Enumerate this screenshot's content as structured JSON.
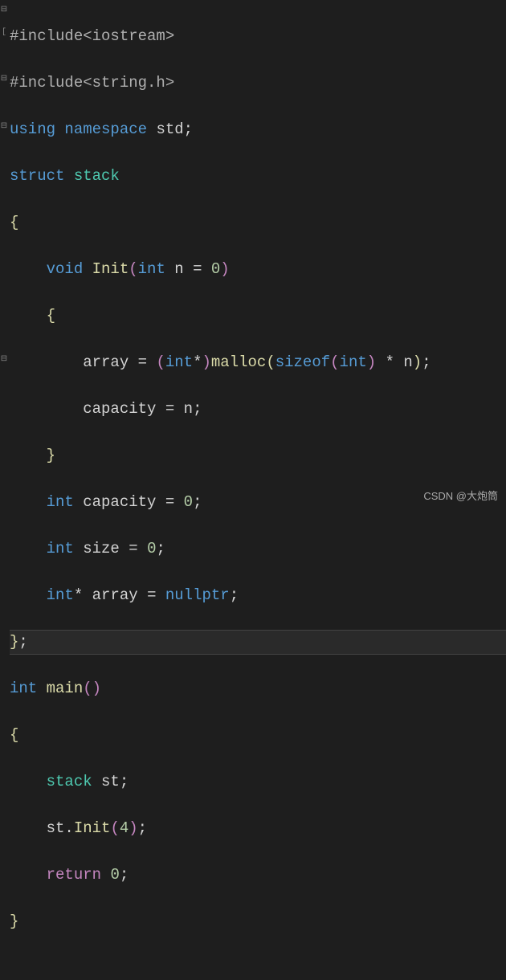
{
  "gutter": {
    "fold1": "⊟",
    "fold2": "[",
    "fold3": "⊟",
    "fold4": "⊟",
    "fold5": "⊟"
  },
  "code": {
    "l1": {
      "s1": "#include",
      "s2": "<iostream>"
    },
    "l2": {
      "s1": "#include",
      "s2": "<string.h>"
    },
    "l3": {
      "s1": "using",
      "s2": " ",
      "s3": "namespace",
      "s4": " std",
      "s5": ";"
    },
    "l4": {
      "s1": "struct",
      "s2": " ",
      "s3": "stack"
    },
    "l5": {
      "s1": "{"
    },
    "l6": {
      "s1": "    ",
      "s2": "void",
      "s3": " ",
      "s4": "Init",
      "s5": "(",
      "s6": "int",
      "s7": " n ",
      "s8": "=",
      "s9": " ",
      "s10": "0",
      "s11": ")"
    },
    "l7": {
      "s1": "    ",
      "s2": "{"
    },
    "l8": {
      "s1": "        array ",
      "s2": "=",
      "s3": " ",
      "s4": "(",
      "s5": "int",
      "s6": "*",
      "s7": ")",
      "s8": "malloc",
      "s9": "(",
      "s10": "sizeof",
      "s11": "(",
      "s12": "int",
      "s13": ")",
      "s14": " ",
      "s15": "*",
      "s16": " n",
      "s17": ")",
      "s18": ";"
    },
    "l9": {
      "s1": "        capacity ",
      "s2": "=",
      "s3": " n",
      "s4": ";"
    },
    "l10": {
      "s1": "    ",
      "s2": "}"
    },
    "l11": {
      "s1": "    ",
      "s2": "int",
      "s3": " capacity ",
      "s4": "=",
      "s5": " ",
      "s6": "0",
      "s7": ";"
    },
    "l12": {
      "s1": "    ",
      "s2": "int",
      "s3": " size ",
      "s4": "=",
      "s5": " ",
      "s6": "0",
      "s7": ";"
    },
    "l13": {
      "s1": "    ",
      "s2": "int",
      "s3": "*",
      "s4": " array ",
      "s5": "=",
      "s6": " ",
      "s7": "nullptr",
      "s8": ";"
    },
    "l14": {
      "s1": "}",
      "s2": ";"
    },
    "l15": {
      "s1": "int",
      "s2": " ",
      "s3": "main",
      "s4": "()"
    },
    "l16": {
      "s1": "{"
    },
    "l17": {
      "s1": "    ",
      "s2": "stack",
      "s3": " st",
      "s4": ";"
    },
    "l18": {
      "s1": "    st",
      "s2": ".",
      "s3": "Init",
      "s4": "(",
      "s5": "4",
      "s6": ")",
      "s7": ";"
    },
    "l19": {
      "s1": "    ",
      "s2": "return",
      "s3": " ",
      "s4": "0",
      "s5": ";"
    },
    "l20": {
      "s1": "}"
    }
  },
  "watermark": "CSDN @大炮筒"
}
